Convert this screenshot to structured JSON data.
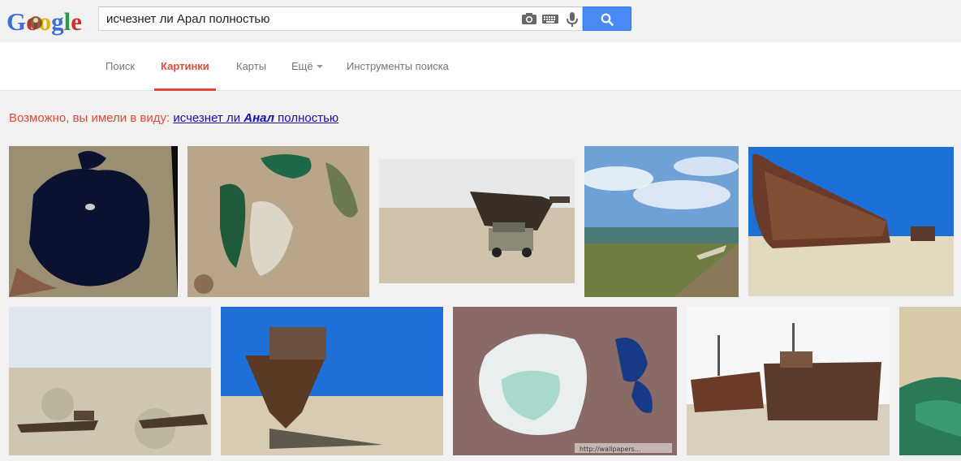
{
  "header": {
    "logo_text": "Google",
    "search_query": "исчезнет ли Арал полностью",
    "icons": [
      "camera-icon",
      "keyboard-icon",
      "microphone-icon",
      "search-icon"
    ]
  },
  "nav": {
    "tabs": [
      {
        "label": "Поиск",
        "active": false
      },
      {
        "label": "Картинки",
        "active": true
      },
      {
        "label": "Карты",
        "active": false
      },
      {
        "label": "Ещё",
        "active": false
      },
      {
        "label": "Инструменты поиска",
        "active": false
      }
    ]
  },
  "suggestion": {
    "prefix": "Возможно, вы имели в виду:",
    "link_before": "исчезнет ли ",
    "link_bold": "Анал",
    "link_after": " полностью"
  },
  "results": {
    "watermark": "http://wallpapers...",
    "images": [
      {
        "subject": "satellite Aral Sea dark"
      },
      {
        "subject": "satellite Aral Sea green"
      },
      {
        "subject": "ship wreck with jeep in desert"
      },
      {
        "subject": "sea shore with boat and clouds"
      },
      {
        "subject": "rusty ship on sand"
      },
      {
        "subject": "ship graveyard in desert"
      },
      {
        "subject": "rusty ship bow blue sky"
      },
      {
        "subject": "satellite Aral Sea salt flats"
      },
      {
        "subject": "two rusty ships"
      },
      {
        "subject": "aerial coast view"
      }
    ]
  },
  "colors": {
    "accent": "#dd4b39",
    "link": "#1a0dab",
    "search_button": "#4a8af4"
  }
}
